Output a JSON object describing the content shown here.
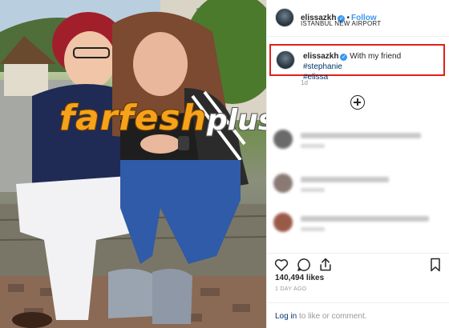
{
  "post": {
    "username": "elissazkh",
    "follow_label": "Follow",
    "location": "ISTANBUL NEW AIRPORT",
    "caption_plain": " With my friend ",
    "caption_tag1": "#stephanie",
    "caption_tag2": "#elissa",
    "time_ago": "1d",
    "likes": "140,494 likes",
    "posted": "1 DAY AGO",
    "login_link": "Log in",
    "login_suffix": " to like or comment."
  },
  "watermark": {
    "main": "farfesh",
    "plus": "plus.com"
  },
  "icons": {
    "verified": "verified-badge-icon",
    "load_more": "plus-circle-icon",
    "like": "heart-icon",
    "comment": "comment-bubble-icon",
    "share": "share-icon",
    "save": "bookmark-icon"
  },
  "colors": {
    "accent_link": "#3897f0",
    "hashtag": "#003569",
    "highlight_box": "#e0201a",
    "watermark_orange": "#f6a21a"
  }
}
